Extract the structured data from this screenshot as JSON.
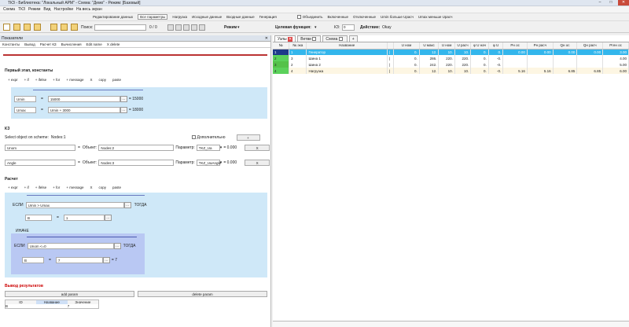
{
  "window": {
    "title": "ТКЗ - Библиотека: \"Локальный АРМ\" - Схема: \"Демо\" - Режим: [Базовый]"
  },
  "menu": [
    "Схема",
    "ТКЗ",
    "Режим",
    "Вид",
    "Настройки",
    "На весь экран"
  ],
  "filters": {
    "items": [
      "Редактирование данных",
      "Все параметры",
      "Нагрузка",
      "Исходные данные",
      "Входные данные",
      "Генерация"
    ],
    "checks": [
      "Объединить",
      "Включенные",
      "Отключенные",
      "Umin больше Uрасч",
      "Umax меньше Uрасч"
    ]
  },
  "toolbar": {
    "search_label": "Поиск:",
    "counter": "0 / 0",
    "mode_label": "Режим",
    "target_label": "Целевая функция:",
    "kz_label": "КЗ:",
    "kz_value": "0",
    "action_label": "Действие:",
    "action_value": "Okay"
  },
  "left": {
    "header": "Показатели",
    "tabs": [
      "Константы",
      "Вывод",
      "Расчет КЗ",
      "Вычисления",
      "Edit name",
      "X delete"
    ],
    "section1": "Первый этап, константы",
    "ops": [
      "+ expr",
      "+ if",
      "+ ifelse",
      "+ for",
      "+ message",
      "X",
      "copy",
      "paste"
    ],
    "umin": {
      "name": "Umin",
      "eq": "=",
      "expr": "15000",
      "result": "= 15000"
    },
    "umax": {
      "name": "Umax",
      "eq": "=",
      "expr": "Umin + 3000",
      "result": "= 18000"
    },
    "kz_title": "КЗ",
    "select_label": "Select object on scheme:",
    "select_value": "Nodes:1",
    "extra_label": "Дополнительно",
    "plus": "+",
    "row1": {
      "name": "Unom",
      "eq": "=",
      "obj_label": "Объект:",
      "obj": "Nodes:2",
      "param_label": "Параметр:",
      "param": "TKZ_Ua",
      "result": "= 0.000",
      "x": "X"
    },
    "row2": {
      "name": "Angle",
      "eq": "=",
      "obj_label": "Объект:",
      "obj": "Nodes:3",
      "param_label": "Параметр:",
      "param": "TKZ_UaAngle",
      "result": "= 0.000",
      "x": "X"
    },
    "section2": "Расчет",
    "if": {
      "label": "ЕСЛИ",
      "cond": "Umin > Umax",
      "then": "ТОГДА",
      "var": "B",
      "eq": "=",
      "val": "1"
    },
    "else": "ИНАЧЕ",
    "if2": {
      "label": "ЕСЛИ",
      "cond": "Unom <=0",
      "then": "ТОГДА",
      "var": "B",
      "eq": "=",
      "val": "7",
      "result": "= 7"
    },
    "output_title": "Вывод результатов",
    "add_param": "add param",
    "delete_param": "delete param",
    "table_headers": [
      "ID",
      "Название",
      "Значение"
    ],
    "table_rows": [
      [
        "B",
        "",
        "7"
      ]
    ]
  },
  "right": {
    "tabs": [
      "Узлы",
      "Ветви",
      "Схема"
    ],
    "headers": [
      "№",
      "№ эка",
      "Название",
      "",
      "U ном",
      "U макс",
      "U ном",
      "U расч",
      "φ U нач",
      "φ U",
      "Pн ос",
      "Pн расч",
      "Qн ос",
      "Qн расч",
      "Pген ос"
    ],
    "rows": [
      [
        "1",
        "1",
        "Генератор",
        "|",
        "0.",
        "12.",
        "10.",
        "10.",
        "0.",
        "0.",
        "0.00",
        "0.00",
        "0.00",
        "0.00",
        "3.00"
      ],
      [
        "2",
        "3",
        "Шина 1",
        "|",
        "0.",
        "286.",
        "220.",
        "220.",
        "0.",
        "-0.",
        "",
        "",
        "",
        "",
        "4.00"
      ],
      [
        "3",
        "2",
        "Шина 2",
        "|",
        "0.",
        "242.",
        "220.",
        "220.",
        "0.",
        "-0.",
        "",
        "",
        "",
        "",
        "5.00"
      ],
      [
        "4",
        "4",
        "Нагрузка",
        "|",
        "0.",
        "12.",
        "10.",
        "10.",
        "0.",
        "-0.",
        "5.16",
        "5.16",
        "6.85",
        "6.85",
        "6.00"
      ]
    ]
  }
}
